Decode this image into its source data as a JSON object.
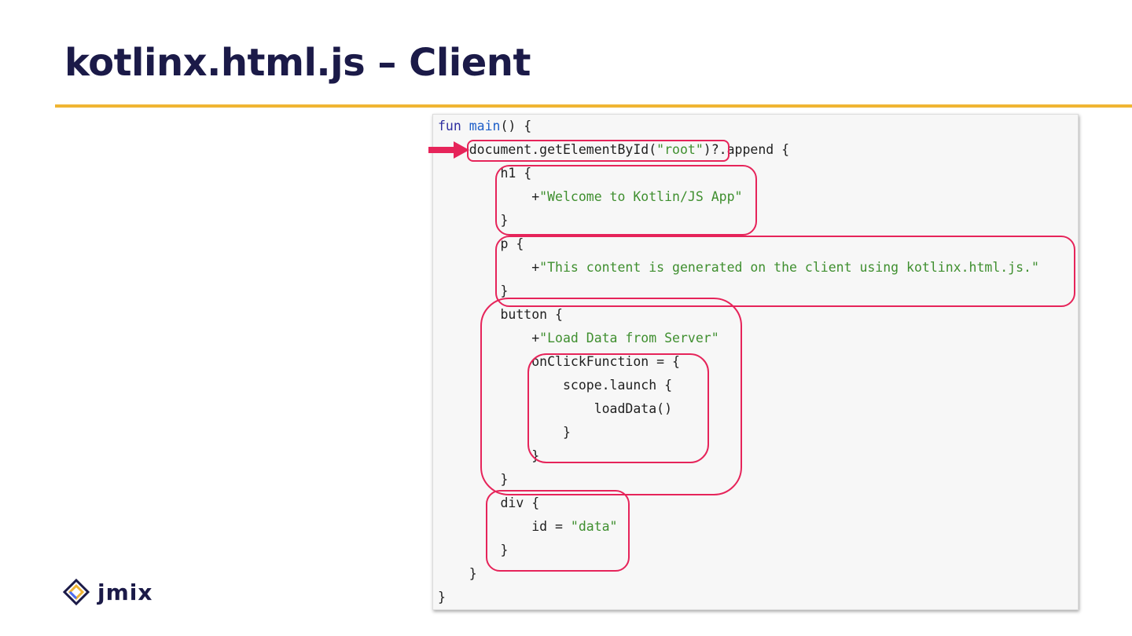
{
  "slide": {
    "title": "kotlinx.html.js – Client"
  },
  "code": {
    "lines": [
      {
        "kw": "fun ",
        "fn": "main",
        "rest": "() {"
      },
      {
        "pre": "document.getElementById(",
        "str": "\"root\"",
        "post": ")?.append {"
      },
      {
        "text": "h1 {"
      },
      {
        "pre": "+",
        "str": "\"Welcome to Kotlin/JS App\""
      },
      {
        "text": "}"
      },
      {
        "text": "p {"
      },
      {
        "pre": "+",
        "str": "\"This content is generated on the client using kotlinx.html.js.\""
      },
      {
        "text": "}"
      },
      {
        "text": "button {"
      },
      {
        "pre": "+",
        "str": "\"Load Data from Server\""
      },
      {
        "text": "onClickFunction = {"
      },
      {
        "text": "scope.launch {"
      },
      {
        "text": "loadData()"
      },
      {
        "text": "}"
      },
      {
        "text": "}"
      },
      {
        "text": "}"
      },
      {
        "text": "div {"
      },
      {
        "pre": "id = ",
        "str": "\"data\""
      },
      {
        "text": "}"
      },
      {
        "text": "}"
      },
      {
        "text": "}"
      }
    ]
  },
  "colors": {
    "accent_rule": "#f0b533",
    "highlight": "#e6245a",
    "title_text": "#1b1a48"
  },
  "logo": {
    "text": "jmix",
    "icon": "jmix-logo-icon"
  }
}
